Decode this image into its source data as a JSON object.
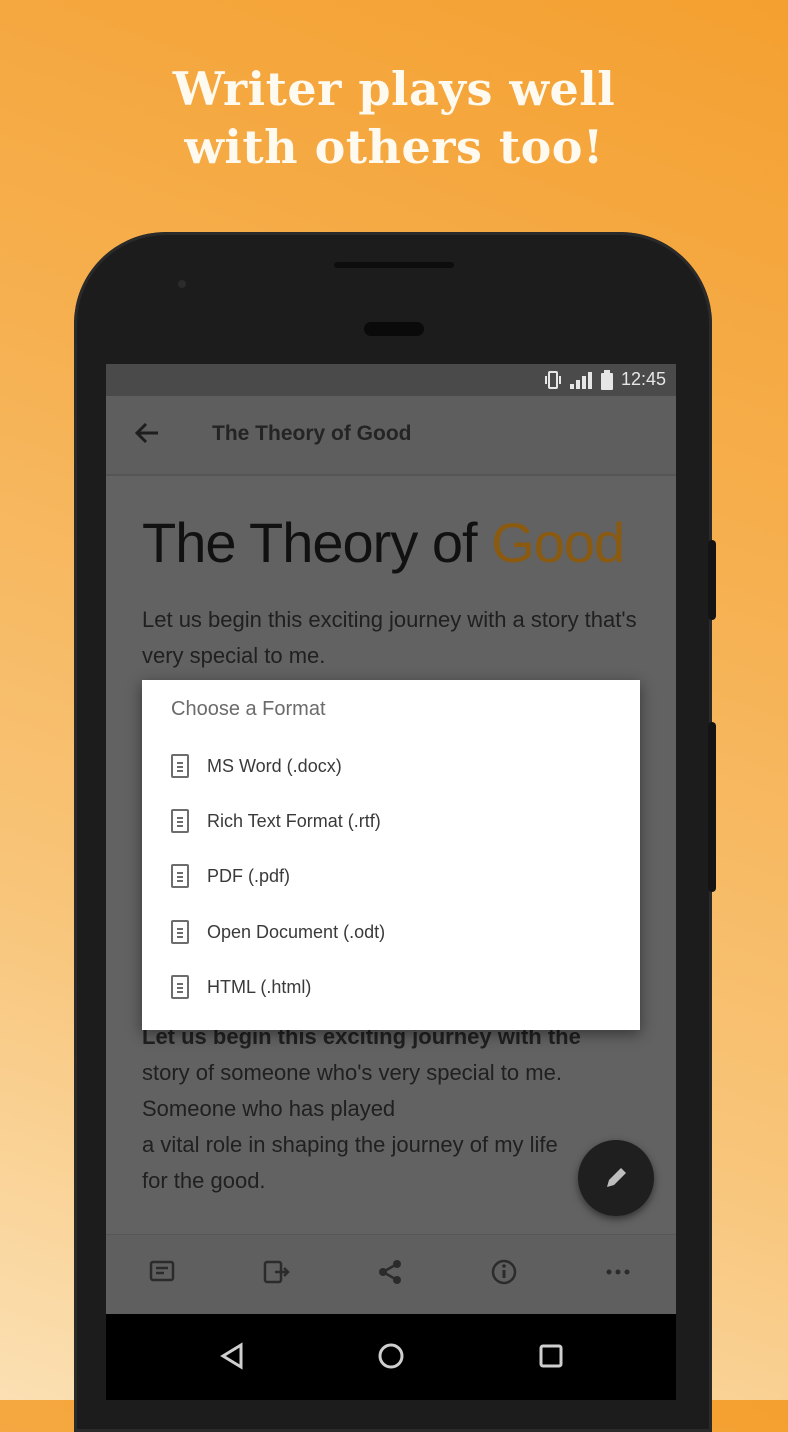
{
  "headline": {
    "line1": "Writer plays well",
    "line2": "with others too!"
  },
  "status_bar": {
    "time": "12:45"
  },
  "app_bar": {
    "back_icon": "arrow-back-icon",
    "title": "The Theory of Good"
  },
  "document": {
    "title_main": "The Theory of ",
    "title_accent": "Good",
    "accent_color": "#8a5a10",
    "intro": "Let us begin this exciting journey with a story that's very special to me.",
    "body_bold": "Let us begin this exciting journey with the",
    "body_rest_1": "story of someone who's very special to me.",
    "body_rest_2": "Someone who has played",
    "body_rest_3": "a vital role in shaping the journey of my life",
    "body_rest_4": "for the good."
  },
  "dialog": {
    "title": "Choose a Format",
    "options": [
      {
        "label": "MS Word (.docx)",
        "icon": "document-icon"
      },
      {
        "label": "Rich Text Format (.rtf)",
        "icon": "document-icon"
      },
      {
        "label": "PDF (.pdf)",
        "icon": "document-icon"
      },
      {
        "label": "Open Document (.odt)",
        "icon": "document-icon"
      },
      {
        "label": "HTML (.html)",
        "icon": "document-icon"
      }
    ]
  },
  "fab": {
    "icon": "pencil-icon"
  },
  "bottom_toolbar": {
    "items": [
      "preview-icon",
      "export-icon",
      "share-icon",
      "info-icon",
      "more-icon"
    ]
  },
  "nav_bar": {
    "items": [
      "back-triangle-icon",
      "home-circle-icon",
      "recents-square-icon"
    ]
  },
  "colors": {
    "background_top": "#f4a030",
    "background_bottom": "#fbe0b3",
    "phone": "#1c1c1c"
  }
}
